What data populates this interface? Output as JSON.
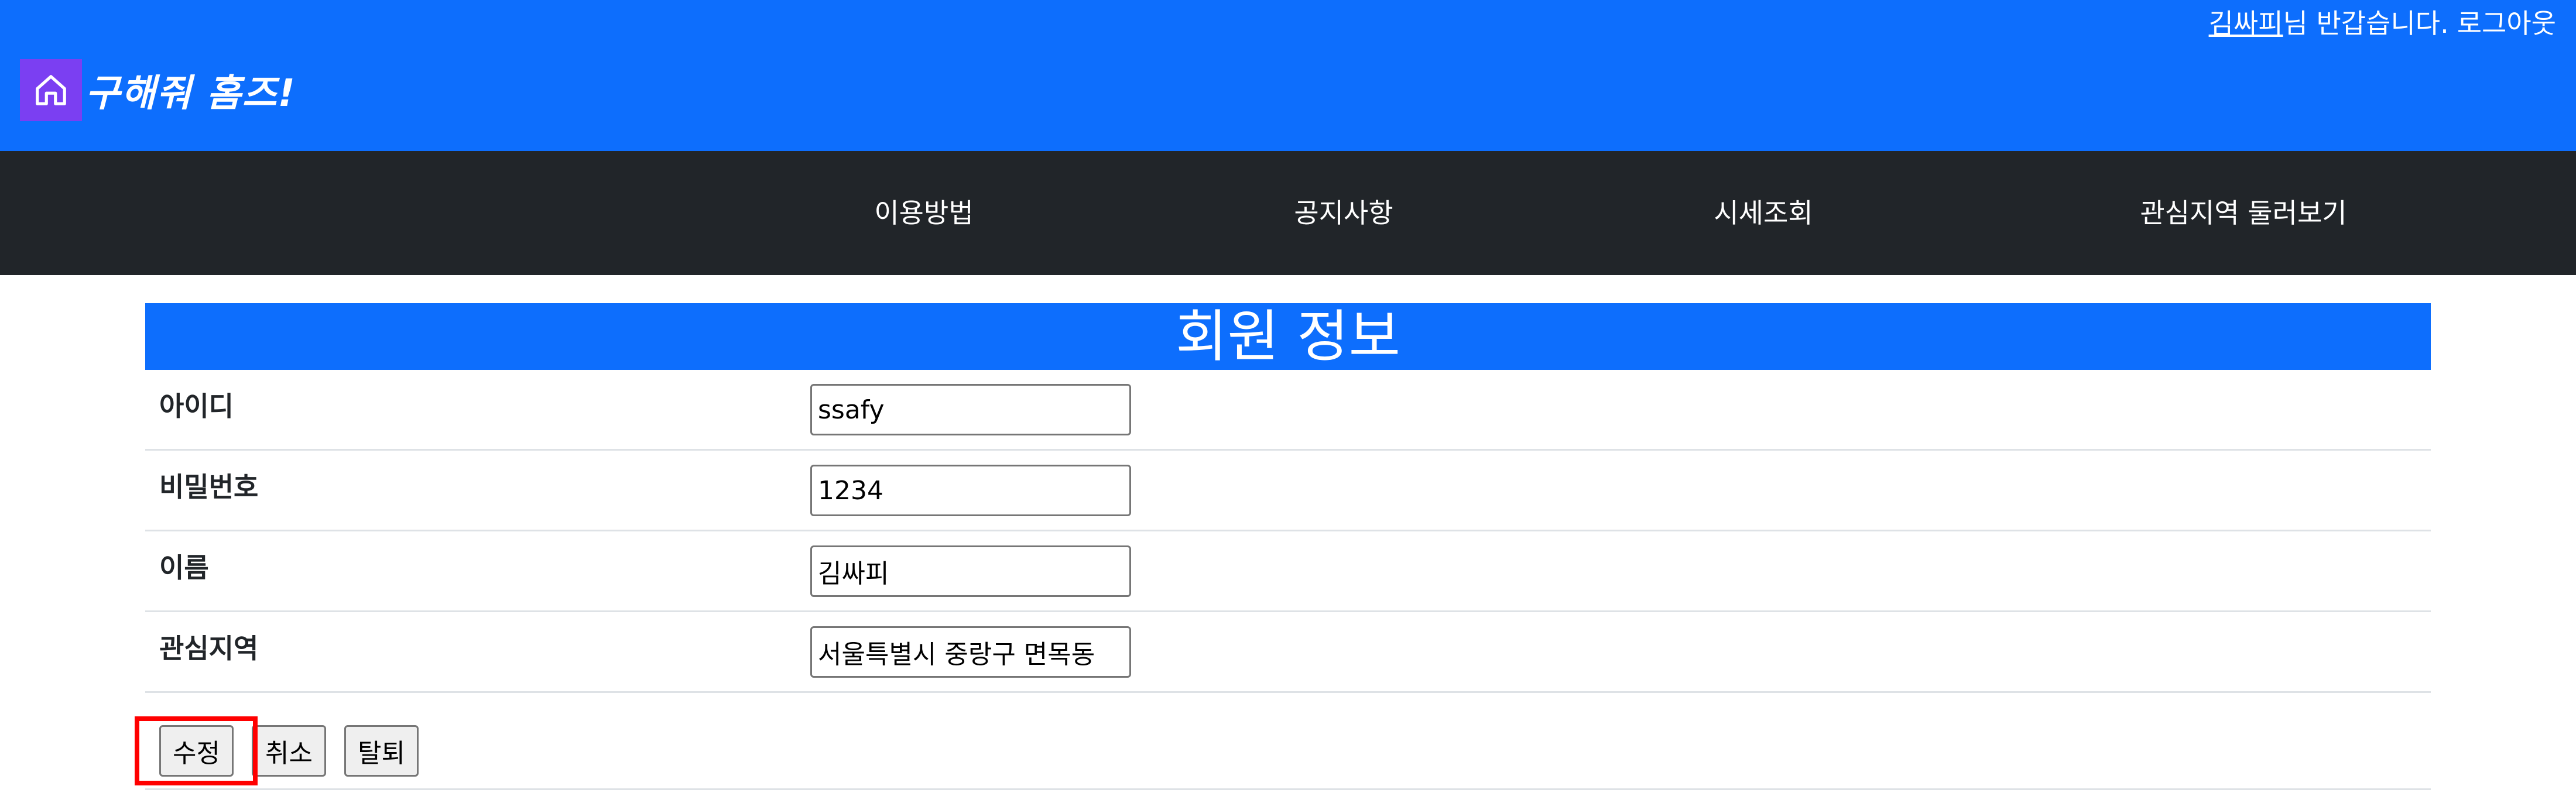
{
  "header": {
    "user_name": "김싸피",
    "greeting_suffix": "님 반갑습니다.",
    "logout_label": "로그아웃",
    "logo_text": "구해줘 홈즈!",
    "logo_icon": "house-icon"
  },
  "nav": {
    "items": [
      {
        "label": "이용방법"
      },
      {
        "label": "공지사항"
      },
      {
        "label": "시세조회"
      },
      {
        "label": "관심지역 둘러보기"
      }
    ]
  },
  "page": {
    "title": "회원 정보"
  },
  "form": {
    "fields": [
      {
        "label": "아이디",
        "value": "ssafy"
      },
      {
        "label": "비밀번호",
        "value": "1234"
      },
      {
        "label": "이름",
        "value": "김싸피"
      },
      {
        "label": "관심지역",
        "value": "서울특별시 중랑구 면목동"
      }
    ],
    "buttons": {
      "edit_label": "수정",
      "cancel_label": "취소",
      "withdraw_label": "탈퇴"
    }
  },
  "colors": {
    "header_bg": "#0d6efd",
    "nav_bg": "#212529",
    "logo_bg": "#7b3ff2",
    "highlight": "#ff0000"
  }
}
